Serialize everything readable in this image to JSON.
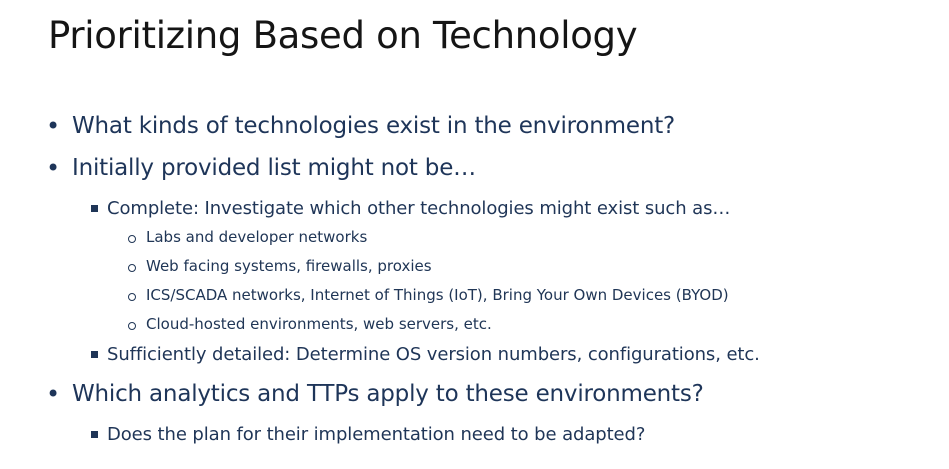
{
  "slide": {
    "title": "Prioritizing Based on Technology",
    "bullets": [
      "What kinds of technologies exist in the environment?",
      "Initially provided list might not be…",
      "Complete: Investigate which other technologies might exist such as…",
      "Labs and developer networks",
      "Web facing systems, firewalls, proxies",
      "ICS/SCADA networks, Internet of Things (IoT), Bring Your Own Devices (BYOD)",
      "Cloud-hosted environments, web servers, etc.",
      "Sufficiently detailed: Determine OS version numbers, configurations, etc.",
      "Which analytics and TTPs apply to these environments?",
      "Does the plan for their implementation need to be adapted?"
    ],
    "bullet_marks": {
      "level1": "•"
    }
  }
}
